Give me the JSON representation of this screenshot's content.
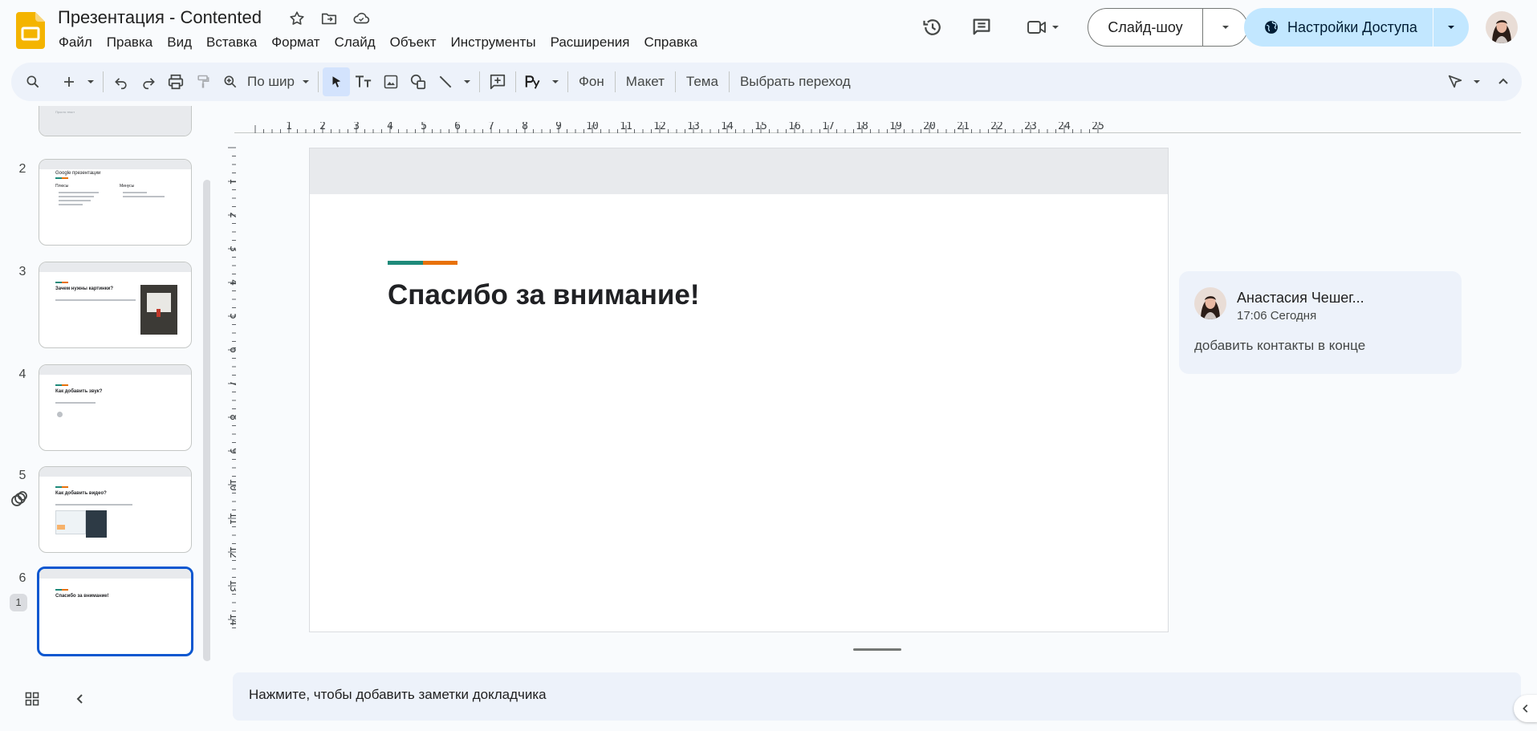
{
  "header": {
    "title": "Презентация - Contented",
    "menu": [
      "Файл",
      "Правка",
      "Вид",
      "Вставка",
      "Формат",
      "Слайд",
      "Объект",
      "Инструменты",
      "Расширения",
      "Справка"
    ],
    "slideshow_label": "Слайд-шоу",
    "share_label": "Настройки Доступа"
  },
  "toolbar": {
    "zoom_label": "По шир",
    "background_label": "Фон",
    "layout_label": "Макет",
    "theme_label": "Тема",
    "transition_label": "Выбрать переход"
  },
  "filmstrip": {
    "slides": [
      {
        "num": "2",
        "title": "Google презентации",
        "col1": "Плюсы",
        "col2": "Минусы"
      },
      {
        "num": "3",
        "title": "Зачем нужны картинки?"
      },
      {
        "num": "4",
        "title": "Как добавить звук?"
      },
      {
        "num": "5",
        "title": "Как добавить видео?"
      },
      {
        "num": "6",
        "title": "Спасибо за внимание!"
      }
    ],
    "slide1_partial_text": "Просто текст",
    "comment_badge": "1"
  },
  "ruler": {
    "top_ticks": [
      "1",
      "2",
      "3",
      "4",
      "5",
      "6",
      "7",
      "8",
      "9",
      "10",
      "11",
      "12",
      "13",
      "14",
      "15",
      "16",
      "17",
      "18",
      "19",
      "20",
      "21",
      "22",
      "23",
      "24",
      "25"
    ],
    "left_ticks": [
      "1",
      "2",
      "3",
      "4",
      "5",
      "6",
      "7",
      "8",
      "9",
      "10",
      "11",
      "12",
      "13",
      "14"
    ]
  },
  "slide": {
    "title": "Спасибо за внимание!",
    "accent_colors": [
      "#1e8a7a",
      "#e8710a"
    ]
  },
  "comment": {
    "author": "Анастасия Чешег...",
    "time": "17:06 Сегодня",
    "text": "добавить контакты в конце"
  },
  "notes": {
    "placeholder": "Нажмите, чтобы добавить заметки докладчика"
  },
  "colors": {
    "accent_blue": "#0b57d0",
    "share_bg": "#c2e7ff",
    "toolbar_bg": "#edf2fa"
  }
}
